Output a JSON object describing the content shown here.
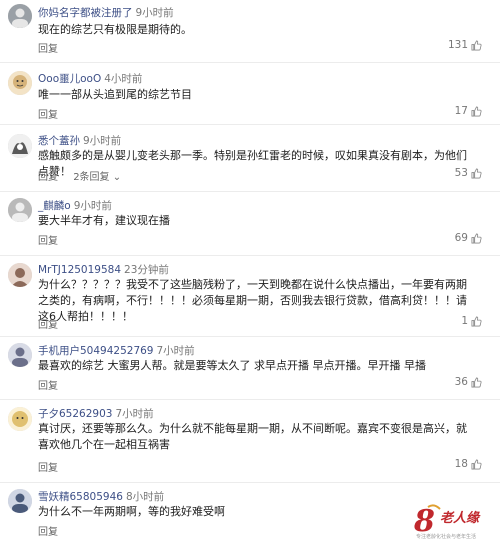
{
  "comments": [
    {
      "username": "你妈名字都被注册了",
      "time": "9小时前",
      "text": "现在的综艺只有极限是期待的。",
      "reply_label": "回复",
      "more_replies": "",
      "likes": "131",
      "avatar_color": "#9aa0a6"
    },
    {
      "username": "Ooo噩儿ooO",
      "time": "4小时前",
      "text": "唯一一部从头追到尾的综艺节目",
      "reply_label": "回复",
      "more_replies": "",
      "likes": "17",
      "avatar_color": "#d6b37a"
    },
    {
      "username": "悉个蓋孙",
      "time": "9小时前",
      "text": "感触颇多的是从婴儿变老头那一季。特别是孙红雷老的时候，叹如果真没有剧本，为他们点赞！",
      "reply_label": "回复",
      "more_replies": "2条回复",
      "likes": "53",
      "avatar_color": "#5a5a5a"
    },
    {
      "username": "_麒麟o",
      "time": "9小时前",
      "text": "要大半年才有，建议现在播",
      "reply_label": "回复",
      "more_replies": "",
      "likes": "69",
      "avatar_color": "#b9b9b9"
    },
    {
      "username": "MrTJ125019584",
      "time": "23分钟前",
      "text": "为什么？？？？？我受不了这些脑残粉了，一天到晚都在说什么快点播出，一年要有两期之类的，有病啊，不行！！！！必须每星期一期，否则我去银行贷款，借高利贷！！！请这6人帮拍！！！！",
      "reply_label": "回复",
      "more_replies": "",
      "likes": "1",
      "avatar_color": "#8c6a5a"
    },
    {
      "username": "手机用户50494252769",
      "time": "7小时前",
      "text": "最喜欢的综艺 大蜜男人帮。就是要等太久了 求早点开播 早点开播。早开播 早播",
      "reply_label": "回复",
      "more_replies": "",
      "likes": "36",
      "avatar_color": "#6b6f8a"
    },
    {
      "username": "子夕65262903",
      "time": "7小时前",
      "text": "真讨厌，还要等那么久。为什么就不能每星期一期，从不间断呢。嘉宾不变很是高兴，就喜欢他几个在一起相互祸害",
      "reply_label": "回复",
      "more_replies": "",
      "likes": "18",
      "avatar_color": "#e0c070"
    },
    {
      "username": "雪妖精65805946",
      "time": "8小时前",
      "text": "为什么不一年两期啊，等的我好难受啊",
      "reply_label": "回复",
      "more_replies": "",
      "likes": "",
      "avatar_color": "#4a5a7a"
    }
  ],
  "watermark": {
    "text": "老人缘",
    "small": "专注老龄化社会与老年生活"
  }
}
